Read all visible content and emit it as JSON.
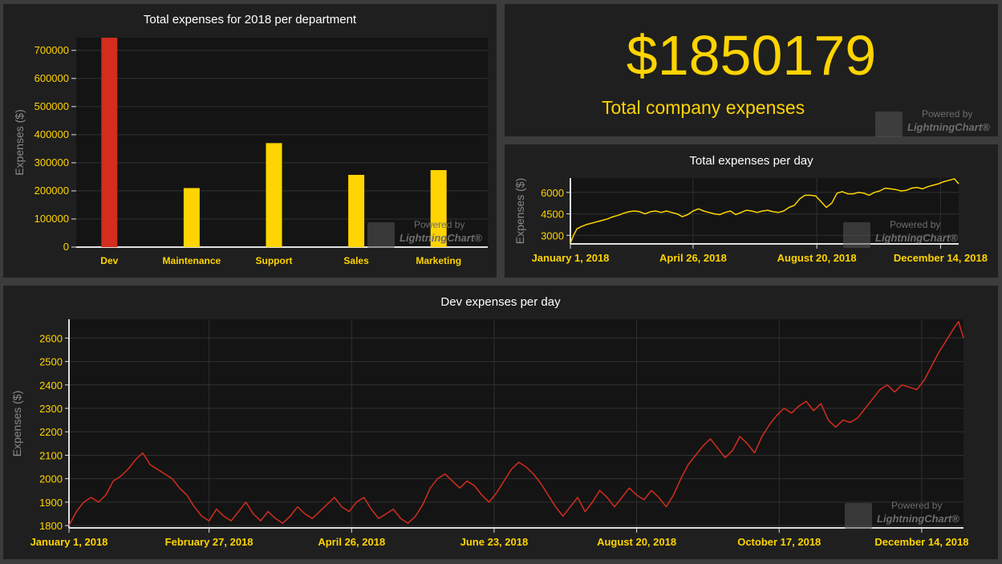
{
  "brand": {
    "powered_by": "Powered by",
    "name": "LightningChart®"
  },
  "colors": {
    "accent": "#ffd400",
    "dev": "#d22d1e",
    "panel": "#1f1f1f",
    "plot": "#141414",
    "grid": "#303030"
  },
  "kpi": {
    "value": "$1850179",
    "caption": "Total company expenses"
  },
  "chart_data": [
    {
      "type": "bar",
      "title": "Total expenses for 2018 per department",
      "ylabel": "Expenses ($)",
      "xlabel": "",
      "categories": [
        "Dev",
        "Maintenance",
        "Support",
        "Sales",
        "Marketing"
      ],
      "values": [
        745000,
        210000,
        370000,
        257000,
        274000
      ],
      "colors": [
        "#d22d1e",
        "#ffd400",
        "#ffd400",
        "#ffd400",
        "#ffd400"
      ],
      "ylim": [
        0,
        745000
      ],
      "yticks": [
        0,
        100000,
        200000,
        300000,
        400000,
        500000,
        600000,
        700000
      ],
      "grid": true
    },
    {
      "type": "line",
      "title": "Total expenses per day",
      "ylabel": "Expenses ($)",
      "xlabel": "",
      "x_start": "January 1, 2018",
      "xlim": [
        0,
        364
      ],
      "xticks": [
        {
          "x": 0,
          "label": "January 1, 2018"
        },
        {
          "x": 115,
          "label": "April 26, 2018"
        },
        {
          "x": 231,
          "label": "August 20, 2018"
        },
        {
          "x": 347,
          "label": "December 14, 2018"
        }
      ],
      "ylim": [
        2400,
        7000
      ],
      "yticks": [
        3000,
        4500,
        6000
      ],
      "color": "#ffd400",
      "grid": true,
      "points": [
        [
          0,
          2450
        ],
        [
          3,
          3000
        ],
        [
          6,
          3450
        ],
        [
          10,
          3600
        ],
        [
          15,
          3750
        ],
        [
          20,
          3850
        ],
        [
          25,
          3950
        ],
        [
          30,
          4050
        ],
        [
          35,
          4150
        ],
        [
          40,
          4300
        ],
        [
          45,
          4400
        ],
        [
          50,
          4550
        ],
        [
          55,
          4650
        ],
        [
          60,
          4700
        ],
        [
          65,
          4650
        ],
        [
          70,
          4500
        ],
        [
          75,
          4650
        ],
        [
          80,
          4700
        ],
        [
          85,
          4600
        ],
        [
          90,
          4700
        ],
        [
          95,
          4600
        ],
        [
          100,
          4500
        ],
        [
          105,
          4300
        ],
        [
          110,
          4450
        ],
        [
          115,
          4700
        ],
        [
          120,
          4850
        ],
        [
          125,
          4700
        ],
        [
          130,
          4600
        ],
        [
          135,
          4500
        ],
        [
          140,
          4450
        ],
        [
          145,
          4600
        ],
        [
          150,
          4700
        ],
        [
          155,
          4450
        ],
        [
          160,
          4600
        ],
        [
          165,
          4750
        ],
        [
          170,
          4700
        ],
        [
          175,
          4600
        ],
        [
          180,
          4700
        ],
        [
          185,
          4750
        ],
        [
          190,
          4650
        ],
        [
          195,
          4600
        ],
        [
          200,
          4700
        ],
        [
          205,
          4950
        ],
        [
          210,
          5100
        ],
        [
          215,
          5550
        ],
        [
          220,
          5800
        ],
        [
          225,
          5800
        ],
        [
          230,
          5750
        ],
        [
          235,
          5350
        ],
        [
          240,
          4950
        ],
        [
          245,
          5250
        ],
        [
          250,
          5950
        ],
        [
          255,
          6050
        ],
        [
          260,
          5900
        ],
        [
          265,
          5900
        ],
        [
          270,
          6000
        ],
        [
          275,
          5950
        ],
        [
          280,
          5800
        ],
        [
          285,
          6000
        ],
        [
          290,
          6100
        ],
        [
          295,
          6300
        ],
        [
          300,
          6250
        ],
        [
          305,
          6200
        ],
        [
          310,
          6100
        ],
        [
          315,
          6150
        ],
        [
          320,
          6300
        ],
        [
          325,
          6350
        ],
        [
          330,
          6250
        ],
        [
          335,
          6400
        ],
        [
          340,
          6500
        ],
        [
          345,
          6600
        ],
        [
          350,
          6750
        ],
        [
          355,
          6850
        ],
        [
          360,
          6950
        ],
        [
          364,
          6600
        ]
      ]
    },
    {
      "type": "line",
      "title": "Dev expenses per day",
      "ylabel": "Expenses ($)",
      "xlabel": "",
      "x_start": "January 1, 2018",
      "xlim": [
        0,
        364
      ],
      "xticks": [
        {
          "x": 0,
          "label": "January 1, 2018"
        },
        {
          "x": 57,
          "label": "February 27, 2018"
        },
        {
          "x": 115,
          "label": "April 26, 2018"
        },
        {
          "x": 173,
          "label": "June 23, 2018"
        },
        {
          "x": 231,
          "label": "August 20, 2018"
        },
        {
          "x": 289,
          "label": "October 17, 2018"
        },
        {
          "x": 347,
          "label": "December 14, 2018"
        }
      ],
      "ylim": [
        1790,
        2680
      ],
      "yticks": [
        1800,
        1900,
        2000,
        2100,
        2200,
        2300,
        2400,
        2500,
        2600
      ],
      "color": "#d22d1e",
      "grid": true,
      "points": [
        [
          0,
          1800
        ],
        [
          3,
          1860
        ],
        [
          6,
          1900
        ],
        [
          9,
          1920
        ],
        [
          12,
          1900
        ],
        [
          15,
          1930
        ],
        [
          18,
          1990
        ],
        [
          21,
          2010
        ],
        [
          24,
          2040
        ],
        [
          27,
          2080
        ],
        [
          30,
          2110
        ],
        [
          33,
          2060
        ],
        [
          36,
          2040
        ],
        [
          39,
          2020
        ],
        [
          42,
          2000
        ],
        [
          45,
          1960
        ],
        [
          48,
          1930
        ],
        [
          51,
          1880
        ],
        [
          54,
          1840
        ],
        [
          57,
          1820
        ],
        [
          60,
          1870
        ],
        [
          63,
          1840
        ],
        [
          66,
          1820
        ],
        [
          69,
          1860
        ],
        [
          72,
          1900
        ],
        [
          75,
          1850
        ],
        [
          78,
          1820
        ],
        [
          81,
          1860
        ],
        [
          84,
          1830
        ],
        [
          87,
          1810
        ],
        [
          90,
          1840
        ],
        [
          93,
          1880
        ],
        [
          96,
          1850
        ],
        [
          99,
          1830
        ],
        [
          102,
          1860
        ],
        [
          105,
          1890
        ],
        [
          108,
          1920
        ],
        [
          111,
          1880
        ],
        [
          114,
          1860
        ],
        [
          117,
          1900
        ],
        [
          120,
          1920
        ],
        [
          123,
          1870
        ],
        [
          126,
          1830
        ],
        [
          129,
          1850
        ],
        [
          132,
          1870
        ],
        [
          135,
          1830
        ],
        [
          138,
          1810
        ],
        [
          141,
          1840
        ],
        [
          144,
          1890
        ],
        [
          147,
          1960
        ],
        [
          150,
          2000
        ],
        [
          153,
          2020
        ],
        [
          156,
          1990
        ],
        [
          159,
          1960
        ],
        [
          162,
          1990
        ],
        [
          165,
          1970
        ],
        [
          168,
          1930
        ],
        [
          171,
          1900
        ],
        [
          174,
          1940
        ],
        [
          177,
          1990
        ],
        [
          180,
          2040
        ],
        [
          183,
          2070
        ],
        [
          186,
          2050
        ],
        [
          189,
          2020
        ],
        [
          192,
          1980
        ],
        [
          195,
          1930
        ],
        [
          198,
          1880
        ],
        [
          201,
          1840
        ],
        [
          204,
          1880
        ],
        [
          207,
          1920
        ],
        [
          210,
          1860
        ],
        [
          213,
          1900
        ],
        [
          216,
          1950
        ],
        [
          219,
          1920
        ],
        [
          222,
          1880
        ],
        [
          225,
          1920
        ],
        [
          228,
          1960
        ],
        [
          231,
          1930
        ],
        [
          234,
          1910
        ],
        [
          237,
          1950
        ],
        [
          240,
          1920
        ],
        [
          243,
          1880
        ],
        [
          246,
          1930
        ],
        [
          249,
          2000
        ],
        [
          252,
          2060
        ],
        [
          255,
          2100
        ],
        [
          258,
          2140
        ],
        [
          261,
          2170
        ],
        [
          264,
          2130
        ],
        [
          267,
          2090
        ],
        [
          270,
          2120
        ],
        [
          273,
          2180
        ],
        [
          276,
          2150
        ],
        [
          279,
          2110
        ],
        [
          282,
          2180
        ],
        [
          285,
          2230
        ],
        [
          288,
          2270
        ],
        [
          291,
          2300
        ],
        [
          294,
          2280
        ],
        [
          297,
          2310
        ],
        [
          300,
          2330
        ],
        [
          303,
          2290
        ],
        [
          306,
          2320
        ],
        [
          309,
          2250
        ],
        [
          312,
          2220
        ],
        [
          315,
          2250
        ],
        [
          318,
          2240
        ],
        [
          321,
          2260
        ],
        [
          324,
          2300
        ],
        [
          327,
          2340
        ],
        [
          330,
          2380
        ],
        [
          333,
          2400
        ],
        [
          336,
          2370
        ],
        [
          339,
          2400
        ],
        [
          342,
          2390
        ],
        [
          345,
          2380
        ],
        [
          348,
          2420
        ],
        [
          351,
          2480
        ],
        [
          354,
          2540
        ],
        [
          357,
          2590
        ],
        [
          360,
          2640
        ],
        [
          362,
          2670
        ],
        [
          364,
          2600
        ]
      ]
    }
  ]
}
